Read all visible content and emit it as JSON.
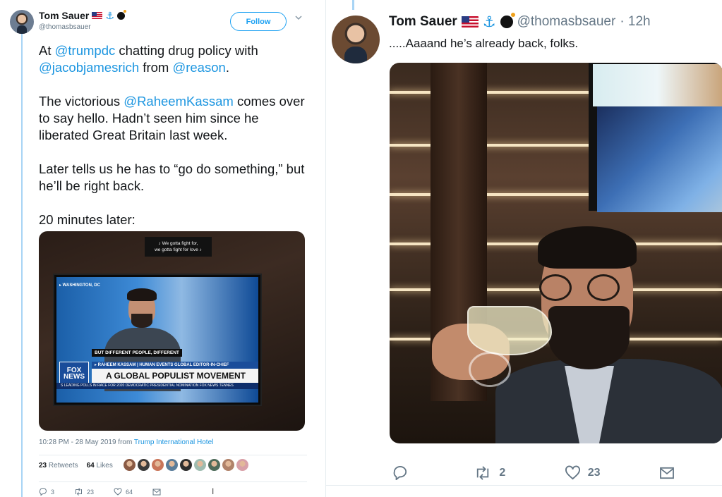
{
  "left_tweet": {
    "author_name": "Tom Sauer",
    "handle": "@thomasbsauer",
    "follow_label": "Follow",
    "body": {
      "p1_pre": "At ",
      "p1_m1": "@trumpdc",
      "p1_mid": " chatting drug policy with ",
      "p1_m2": "@jacobjamesrich",
      "p1_mid2": " from ",
      "p1_m3": "@reason",
      "p1_end": ".",
      "p2_pre": "The victorious ",
      "p2_m1": "@RaheemKassam",
      "p2_rest": " comes over to say hello. Hadn’t seen him since he liberated Great Britain last week.",
      "p3": "Later tells us he has to “go do something,” but he’ll be right back.",
      "p4": "20 minutes later:"
    },
    "media": {
      "lyric_line1": "♪ We gotta fight for,",
      "lyric_line2": "we gotta fight for love ♪",
      "dateline": "▸ WASHINGTON, DC",
      "caption": "BUT DIFFERENT PEOPLE, DIFFERENT",
      "namebar": "▸ RAHEEM KASSAM | HUMAN EVENTS GLOBAL EDITOR-IN-CHIEF",
      "headline": "A GLOBAL POPULIST MOVEMENT",
      "ticker": "S LEADING POLLS IN RACE FOR 2020 DEMOCRATIC PRESIDENTIAL NOMINATION   FOX NEWS   TENNES",
      "logo_line1": "FOX",
      "logo_line2": "NEWS"
    },
    "timestamp": "10:28 PM - 28 May 2019 from ",
    "place": "Trump International Hotel",
    "retweets_count": "23",
    "retweets_label": "Retweets",
    "likes_count": "64",
    "likes_label": "Likes",
    "actions": {
      "reply": "3",
      "retweet": "23",
      "like": "64"
    },
    "liker_colors": [
      "#8a5a44",
      "#3b3b3b",
      "#c9765a",
      "#5a7d9a",
      "#2d2d2d",
      "#9fbcb0",
      "#4e6b5a",
      "#b0826a",
      "#d8a0a8"
    ]
  },
  "right_tweet": {
    "author_name": "Tom Sauer",
    "handle": "@thomasbsauer",
    "time": "· 12h",
    "text": ".....Aaaand he’s already back, folks.",
    "actions": {
      "reply": "",
      "retweet": "2",
      "like": "23"
    }
  },
  "colors": {
    "link": "#1b95e0",
    "accent": "#1da1f2",
    "muted": "#657786"
  }
}
